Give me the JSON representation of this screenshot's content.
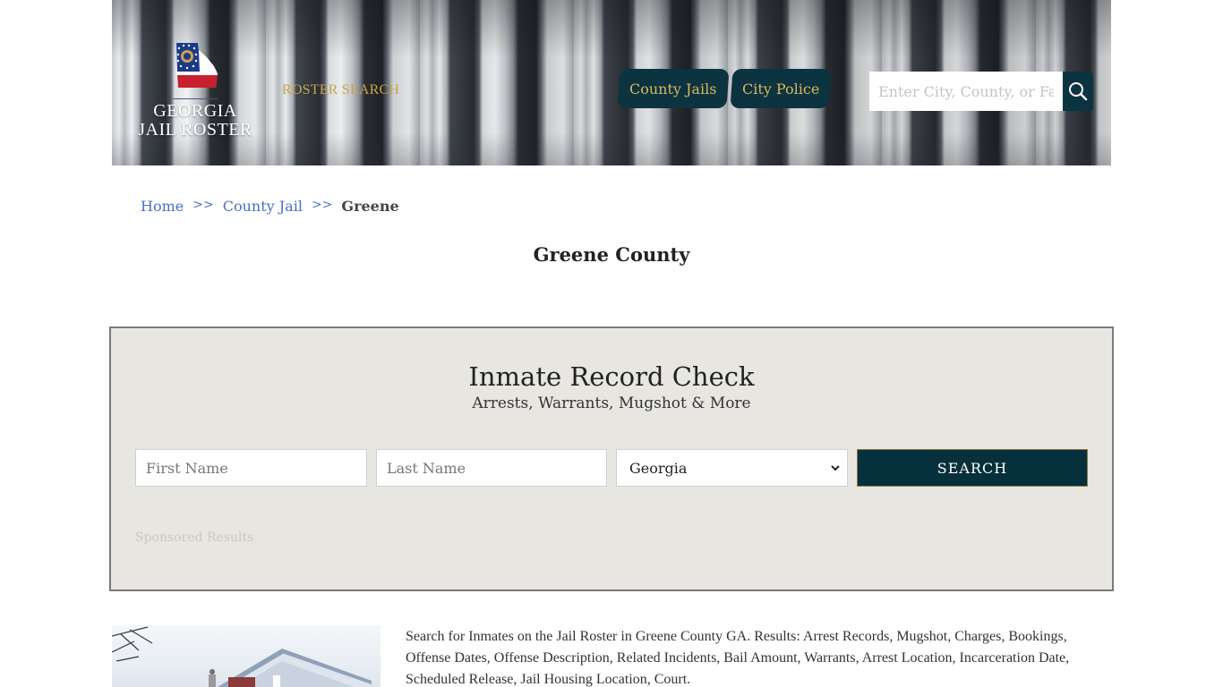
{
  "header": {
    "logo_line1": "GEORGIA",
    "logo_line2": "JAIL ROSTER",
    "roster_search_label": "ROSTER SEARCH",
    "nav_tabs": [
      {
        "label": "County Jails"
      },
      {
        "label": "City Police"
      }
    ],
    "search": {
      "placeholder": "Enter City, County, or Facility",
      "value": "",
      "icon": "search-icon"
    },
    "colors": {
      "nav_bg": "#0c3340",
      "nav_text": "#d9b85c",
      "roster_search": "#c9a447"
    }
  },
  "breadcrumb": {
    "items": [
      {
        "label": "Home"
      },
      {
        "label": "County Jail"
      }
    ],
    "separator": ">>",
    "current": "Greene"
  },
  "page_title": "Greene County",
  "record_check": {
    "title": "Inmate Record Check",
    "subtitle": "Arrests, Warrants, Mugshot & More",
    "first_name": {
      "placeholder": "First Name",
      "value": ""
    },
    "last_name": {
      "placeholder": "Last Name",
      "value": ""
    },
    "state": {
      "selected": "Georgia"
    },
    "search_label": "SEARCH",
    "sponsored_label": "Sponsored Results",
    "colors": {
      "panel_bg": "#e8e6e1",
      "button_bg": "#06303b"
    }
  },
  "content": {
    "image_alt": "Greene County courthouse",
    "description": "Search for Inmates on the Jail Roster in Greene County GA. Results: Arrest Records, Mugshot, Charges, Bookings, Offense Dates, Offense Description, Related Incidents, Bail Amount, Warrants, Arrest Location, Incarceration Date, Scheduled Release, Jail Housing Location, Court."
  }
}
